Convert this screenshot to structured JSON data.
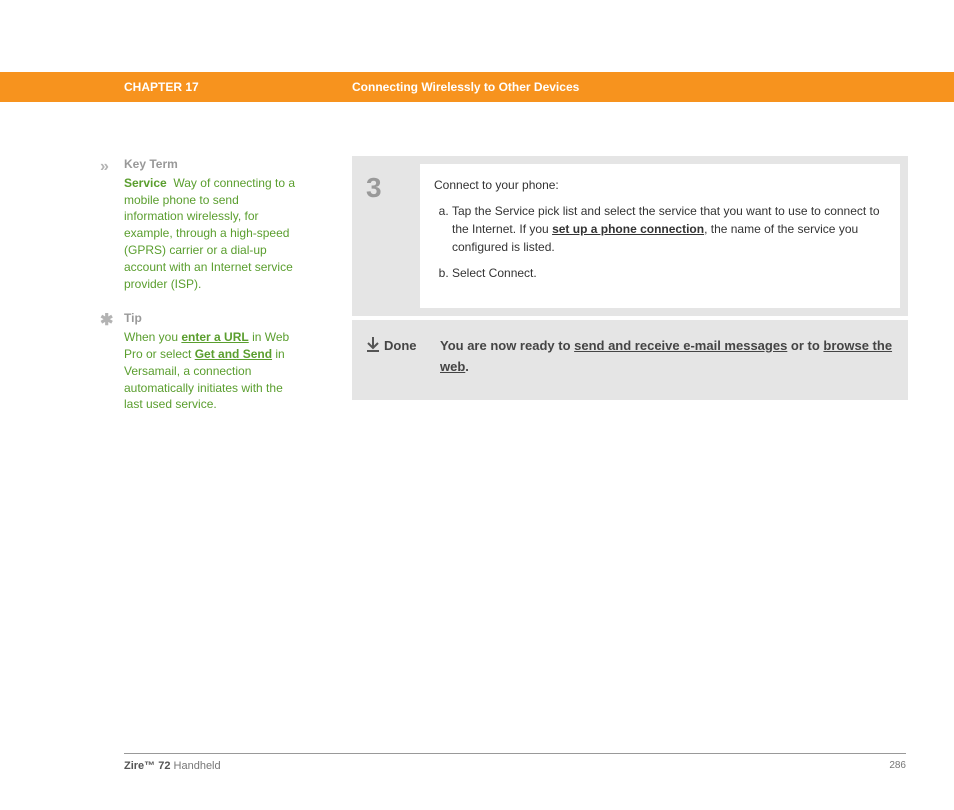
{
  "header": {
    "chapter": "CHAPTER 17",
    "title": "Connecting Wirelessly to Other Devices"
  },
  "sidebar": {
    "keyterm": {
      "icon": "»",
      "heading": "Key Term",
      "label": "Service",
      "body": "Way of connecting to a mobile phone to send information wirelessly, for example, through a high-speed (GPRS) carrier or a dial-up account with an Internet service provider (ISP)."
    },
    "tip": {
      "icon": "✱",
      "heading": "Tip",
      "pre": "When you ",
      "link1": "enter a URL",
      "mid1": " in Web Pro or select ",
      "link2": "Get and Send",
      "post": " in Versamail, a connection automatically initiates with the last used service."
    }
  },
  "step": {
    "number": "3",
    "intro": "Connect to your phone:",
    "a_pre": "Tap the Service pick list and select the service that you want to use to connect to the Internet. If you ",
    "a_link": "set up a phone connection",
    "a_post": ", the name of the service you configured is listed.",
    "b": "Select Connect."
  },
  "done": {
    "icon": "↓",
    "label": "Done",
    "pre": "You are now ready to ",
    "link1": "send and receive e-mail messages",
    "mid": " or to ",
    "link2": "browse the web",
    "post": "."
  },
  "footer": {
    "product_bold": "Zire™ 72",
    "product_rest": " Handheld",
    "page": "286"
  }
}
